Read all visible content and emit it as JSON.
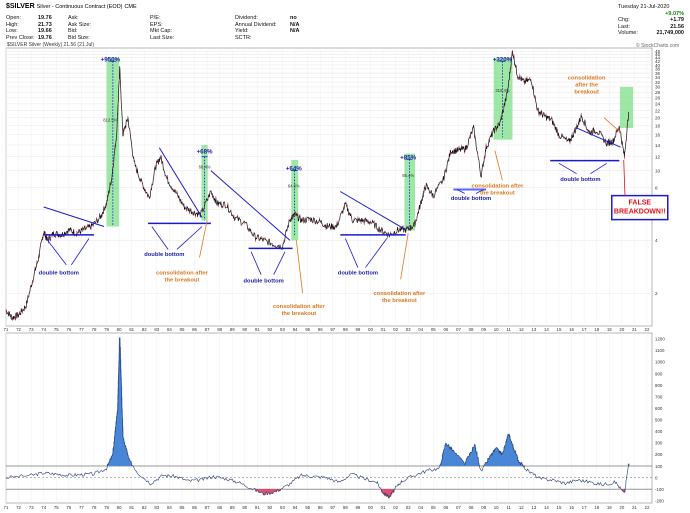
{
  "header": {
    "ticker": "$SILVER",
    "description": "Silver - Continuous Contract (EOD)",
    "exchange": "CME",
    "quote_rows": [
      [
        {
          "k": "Open:",
          "v": "19.76"
        },
        {
          "k": "Ask:",
          "v": ""
        },
        {
          "k": "P/E:",
          "v": ""
        },
        {
          "k": "Dividend:",
          "v": "no"
        }
      ],
      [
        {
          "k": "High:",
          "v": "21.73"
        },
        {
          "k": "Ask Size:",
          "v": ""
        },
        {
          "k": "EPS:",
          "v": ""
        },
        {
          "k": "Annual Dividend:",
          "v": "N/A"
        }
      ],
      [
        {
          "k": "Low:",
          "v": "19.66"
        },
        {
          "k": "Bid:",
          "v": ""
        },
        {
          "k": "Mkt Cap:",
          "v": ""
        },
        {
          "k": "Yield:",
          "v": "N/A"
        }
      ],
      [
        {
          "k": "Prev Close:",
          "v": "19.76"
        },
        {
          "k": "Bid Size:",
          "v": ""
        },
        {
          "k": "Last Size:",
          "v": ""
        },
        {
          "k": "SCTR:",
          "v": ""
        }
      ]
    ],
    "right_panel": {
      "date": "Tuesday  21-Jul-2020",
      "change_pct": "+9.07%",
      "rows": [
        {
          "k": "Chg:",
          "v": "+1.79"
        },
        {
          "k": "Last:",
          "v": "21.56"
        },
        {
          "k": "Volume:",
          "v": "21,749,000"
        }
      ]
    },
    "plot_label": "$SILVER Silver (Weekly) 21.56 (21 Jul)",
    "logo": "© StockCharts.com"
  },
  "colors": {
    "price_line": "#111111",
    "price_alt": "#c0304a",
    "green_box": "#7de08a",
    "blue_line": "#1a1ad6",
    "orange_text": "#d9781e",
    "osc_fill_pos": "#4a86d6",
    "osc_fill_neg": "#e05070",
    "false_box_border": "#1a1ad6",
    "false_text": "#e0101a"
  },
  "chart_data": [
    {
      "type": "line",
      "title": "",
      "scale": "log",
      "x_ticks": [
        "71",
        "72",
        "73",
        "74",
        "75",
        "76",
        "77",
        "78",
        "79",
        "80",
        "81",
        "82",
        "83",
        "84",
        "85",
        "86",
        "87",
        "88",
        "89",
        "90",
        "91",
        "92",
        "93",
        "94",
        "95",
        "96",
        "97",
        "98",
        "99",
        "00",
        "01",
        "02",
        "03",
        "04",
        "05",
        "06",
        "07",
        "08",
        "09",
        "10",
        "11",
        "12",
        "13",
        "14",
        "15",
        "16",
        "17",
        "18",
        "19",
        "20",
        "21",
        "22"
      ],
      "y_ticks": [
        2,
        4,
        6,
        8,
        10,
        12,
        14,
        16,
        18,
        20,
        22,
        24,
        26,
        28,
        30,
        32,
        34,
        36,
        38,
        40,
        42,
        44,
        46,
        48
      ],
      "ylim": [
        1.3,
        50
      ],
      "xlim": [
        1971,
        2022.4
      ],
      "series": [
        {
          "x": [
            1971.0,
            1971.5,
            1972.0,
            1972.6,
            1973.2,
            1973.6,
            1974.0,
            1974.3,
            1974.8,
            1975.4,
            1976.0,
            1976.6,
            1977.2,
            1977.8,
            1978.5,
            1979.0,
            1979.4,
            1979.8,
            1980.05,
            1980.3,
            1980.7,
            1981.2,
            1981.8,
            1982.4,
            1982.9,
            1983.3,
            1983.8,
            1984.5,
            1985.2,
            1985.9,
            1986.5,
            1987.3,
            1987.8,
            1988.5,
            1989.2,
            1990.0,
            1990.8,
            1991.5,
            1992.3,
            1993.0,
            1993.6,
            1994.0,
            1994.5,
            1995.2,
            1996.0,
            1996.6,
            1997.3,
            1998.0,
            1998.6,
            1999.3,
            2000.0,
            2000.8,
            2001.5,
            2002.2,
            2002.9,
            2003.5,
            2004.0,
            2004.4,
            2005.0,
            2005.8,
            2006.4,
            2007.0,
            2007.6,
            2008.2,
            2008.8,
            2009.2,
            2009.8,
            2010.3,
            2010.9,
            2011.3,
            2011.7,
            2012.2,
            2012.8,
            2013.3,
            2013.8,
            2014.4,
            2015.0,
            2015.8,
            2016.3,
            2016.8,
            2017.4,
            2018.0,
            2018.8,
            2019.3,
            2019.8,
            2020.2,
            2020.55
          ],
          "y": [
            1.6,
            1.45,
            1.5,
            1.7,
            2.5,
            3.2,
            4.5,
            4.0,
            4.4,
            4.3,
            4.6,
            4.4,
            4.6,
            4.8,
            5.4,
            6.5,
            9.0,
            16.0,
            38.0,
            16.0,
            20.0,
            11.0,
            8.5,
            7.0,
            10.5,
            12.0,
            9.0,
            7.5,
            6.2,
            5.8,
            5.6,
            7.6,
            6.5,
            6.4,
            5.4,
            5.0,
            4.2,
            4.0,
            3.8,
            3.7,
            5.3,
            5.6,
            5.2,
            5.3,
            5.1,
            4.8,
            4.8,
            6.4,
            5.2,
            5.2,
            5.1,
            4.6,
            4.3,
            4.6,
            4.6,
            4.9,
            6.5,
            8.2,
            7.2,
            8.9,
            13.0,
            13.0,
            13.4,
            17.5,
            9.3,
            13.5,
            16.8,
            18.5,
            28.0,
            48.0,
            35.0,
            32.0,
            33.0,
            22.0,
            20.5,
            19.5,
            16.0,
            14.5,
            17.0,
            20.5,
            16.5,
            17.0,
            14.3,
            14.7,
            18.0,
            12.0,
            21.6
          ]
        }
      ]
    },
    {
      "type": "area",
      "title": "",
      "y_ticks": [
        -200,
        -100,
        0,
        100,
        200,
        300,
        400,
        500,
        600,
        700,
        800,
        900,
        1000,
        1100,
        1200
      ],
      "ylim": [
        -220,
        1250
      ],
      "reference_lines": [
        100,
        0,
        -100
      ],
      "series": [
        {
          "x": [
            1971,
            1973,
            1974,
            1975,
            1976,
            1977,
            1978,
            1979,
            1979.5,
            1979.9,
            1980.05,
            1980.3,
            1980.8,
            1981.5,
            1982.5,
            1983.5,
            1984.5,
            1985.5,
            1986.5,
            1987.5,
            1988.5,
            1989.5,
            1990.5,
            1991.5,
            1992.5,
            1993.5,
            1994.5,
            1995.5,
            1996.5,
            1997.5,
            1998.5,
            1999.5,
            2000.5,
            2001.0,
            2001.5,
            2002.0,
            2002.5,
            2003.5,
            2004.5,
            2005.5,
            2006.0,
            2006.5,
            2007.5,
            2008.3,
            2008.8,
            2009.5,
            2010.0,
            2010.5,
            2011.0,
            2011.4,
            2011.8,
            2012.5,
            2013.5,
            2014.5,
            2015.5,
            2016.5,
            2017.5,
            2018.5,
            2019.5,
            2020.2,
            2020.55
          ],
          "y": [
            0,
            20,
            40,
            30,
            20,
            25,
            30,
            80,
            200,
            600,
            1200,
            350,
            150,
            40,
            -50,
            20,
            10,
            -30,
            -20,
            10,
            -10,
            -40,
            -90,
            -140,
            -120,
            -60,
            20,
            10,
            0,
            -40,
            30,
            -10,
            -40,
            -130,
            -170,
            -90,
            -30,
            20,
            60,
            80,
            300,
            240,
            120,
            280,
            50,
            180,
            250,
            200,
            380,
            250,
            140,
            60,
            -10,
            -20,
            -50,
            -20,
            -40,
            -60,
            -40,
            -140,
            120
          ]
        }
      ]
    }
  ],
  "annotations": {
    "pct_labels": [
      {
        "text": "+950%",
        "x": 1979.3,
        "y": 42
      },
      {
        "text": "+68%",
        "x": 1986.8,
        "y": 12.5
      },
      {
        "text": "+64%",
        "x": 1993.9,
        "y": 10.0
      },
      {
        "text": "+85%",
        "x": 2003.0,
        "y": 11.6
      },
      {
        "text": "+320%",
        "x": 2010.5,
        "y": 42
      }
    ],
    "box_inner_labels": [
      {
        "text": "812.5%",
        "x": 1979.3,
        "y": 19
      },
      {
        "text": "66.4%",
        "x": 1986.8,
        "y": 10.3
      },
      {
        "text": "64.0%",
        "x": 1993.9,
        "y": 8.0
      },
      {
        "text": "85.4%",
        "x": 2003.0,
        "y": 9.2
      },
      {
        "text": "319.4%",
        "x": 2010.5,
        "y": 28
      }
    ],
    "double_bottom": [
      {
        "text": "double bottom",
        "x": 1975.2,
        "y": 2.55
      },
      {
        "text": "double bottom",
        "x": 1983.6,
        "y": 3.25
      },
      {
        "text": "double bottom",
        "x": 1991.5,
        "y": 2.3
      },
      {
        "text": "double bottom",
        "x": 1999.0,
        "y": 2.55
      },
      {
        "text": "double bottom",
        "x": 2008.0,
        "y": 6.8
      },
      {
        "text": "double bottom",
        "x": 2016.7,
        "y": 8.7
      }
    ],
    "consolidation": [
      {
        "lines": [
          "consolidation after",
          "the breakout"
        ],
        "x": 1985.0,
        "y": 2.55
      },
      {
        "lines": [
          "consolidation after",
          "the breakout"
        ],
        "x": 1994.3,
        "y": 1.65
      },
      {
        "lines": [
          "consolidation after",
          "the breakout"
        ],
        "x": 2002.3,
        "y": 1.95
      },
      {
        "lines": [
          "consolidation after",
          "the breakout"
        ],
        "x": 2010.1,
        "y": 8.0
      },
      {
        "lines": [
          "consolidation",
          "after the",
          "breakout"
        ],
        "x": 2017.2,
        "y": 33
      }
    ],
    "false_breakdown": [
      "FALSE",
      "BREAKDOWN!!"
    ]
  }
}
